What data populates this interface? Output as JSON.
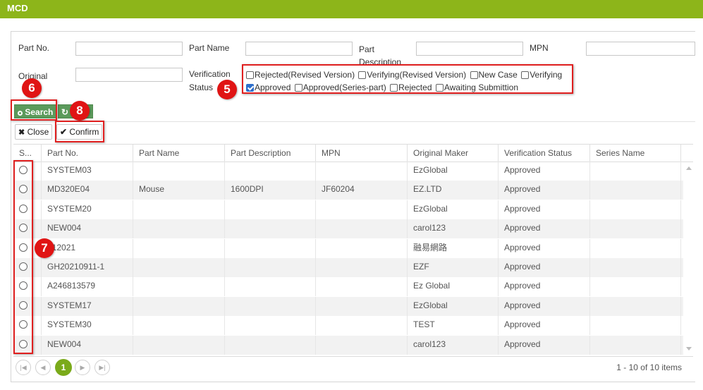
{
  "window": {
    "title": "MCD"
  },
  "filters": {
    "part_no_label": "Part No.",
    "part_name_label": "Part Name",
    "part_desc_label": "Part Description",
    "mpn_label": "MPN",
    "original_maker_label": "Original Maker",
    "verification_status_label_1": "Verification",
    "verification_status_label_2": "Status"
  },
  "verification_options": [
    {
      "label": "Rejected(Revised Version)",
      "checked": false
    },
    {
      "label": "Verifying(Revised Version)",
      "checked": false
    },
    {
      "label": "New Case",
      "checked": false
    },
    {
      "label": "Verifying",
      "checked": false
    },
    {
      "label": "Approved",
      "checked": true
    },
    {
      "label": "Approved(Series-part)",
      "checked": false
    },
    {
      "label": "Rejected",
      "checked": false
    },
    {
      "label": "Awaiting Submittion",
      "checked": false
    }
  ],
  "toolbar": {
    "search_label": "Search",
    "close_label": "Close",
    "confirm_label": "Confirm"
  },
  "badges": {
    "b5": "5",
    "b6": "6",
    "b7": "7",
    "b8": "8"
  },
  "grid": {
    "columns": [
      "S...",
      "Part No.",
      "Part Name",
      "Part Description",
      "MPN",
      "Original Maker",
      "Verification Status",
      "Series Name"
    ],
    "rows": [
      {
        "part_no": "SYSTEM03",
        "part_name": "",
        "part_desc": "",
        "mpn": "",
        "maker": "EzGlobal",
        "status": "Approved",
        "series": ""
      },
      {
        "part_no": "MD320E04",
        "part_name": "Mouse",
        "part_desc": "1600DPI",
        "mpn": "JF60204",
        "maker": "EZ.LTD",
        "status": "Approved",
        "series": ""
      },
      {
        "part_no": "SYSTEM20",
        "part_name": "",
        "part_desc": "",
        "mpn": "",
        "maker": "EzGlobal",
        "status": "Approved",
        "series": ""
      },
      {
        "part_no": "NEW004",
        "part_name": "",
        "part_desc": "",
        "mpn": "",
        "maker": "carol123",
        "status": "Approved",
        "series": ""
      },
      {
        "part_no": "..12021",
        "part_name": "",
        "part_desc": "",
        "mpn": "",
        "maker": "融易網路",
        "status": "Approved",
        "series": ""
      },
      {
        "part_no": "GH20210911-1",
        "part_name": "",
        "part_desc": "",
        "mpn": "",
        "maker": "EZF",
        "status": "Approved",
        "series": ""
      },
      {
        "part_no": "A246813579",
        "part_name": "",
        "part_desc": "",
        "mpn": "",
        "maker": "Ez Global",
        "status": "Approved",
        "series": ""
      },
      {
        "part_no": "SYSTEM17",
        "part_name": "",
        "part_desc": "",
        "mpn": "",
        "maker": "EzGlobal",
        "status": "Approved",
        "series": ""
      },
      {
        "part_no": "SYSTEM30",
        "part_name": "",
        "part_desc": "",
        "mpn": "",
        "maker": "TEST",
        "status": "Approved",
        "series": ""
      },
      {
        "part_no": "NEW004",
        "part_name": "",
        "part_desc": "",
        "mpn": "",
        "maker": "carol123",
        "status": "Approved",
        "series": ""
      }
    ]
  },
  "pager": {
    "current_page": "1",
    "info": "1 - 10 of 10 items"
  },
  "colors": {
    "title_bar": "#8db51a",
    "accent": "#7aaa1a",
    "highlight_box": "#e01f1f",
    "search_button": "#5b9a5b"
  }
}
